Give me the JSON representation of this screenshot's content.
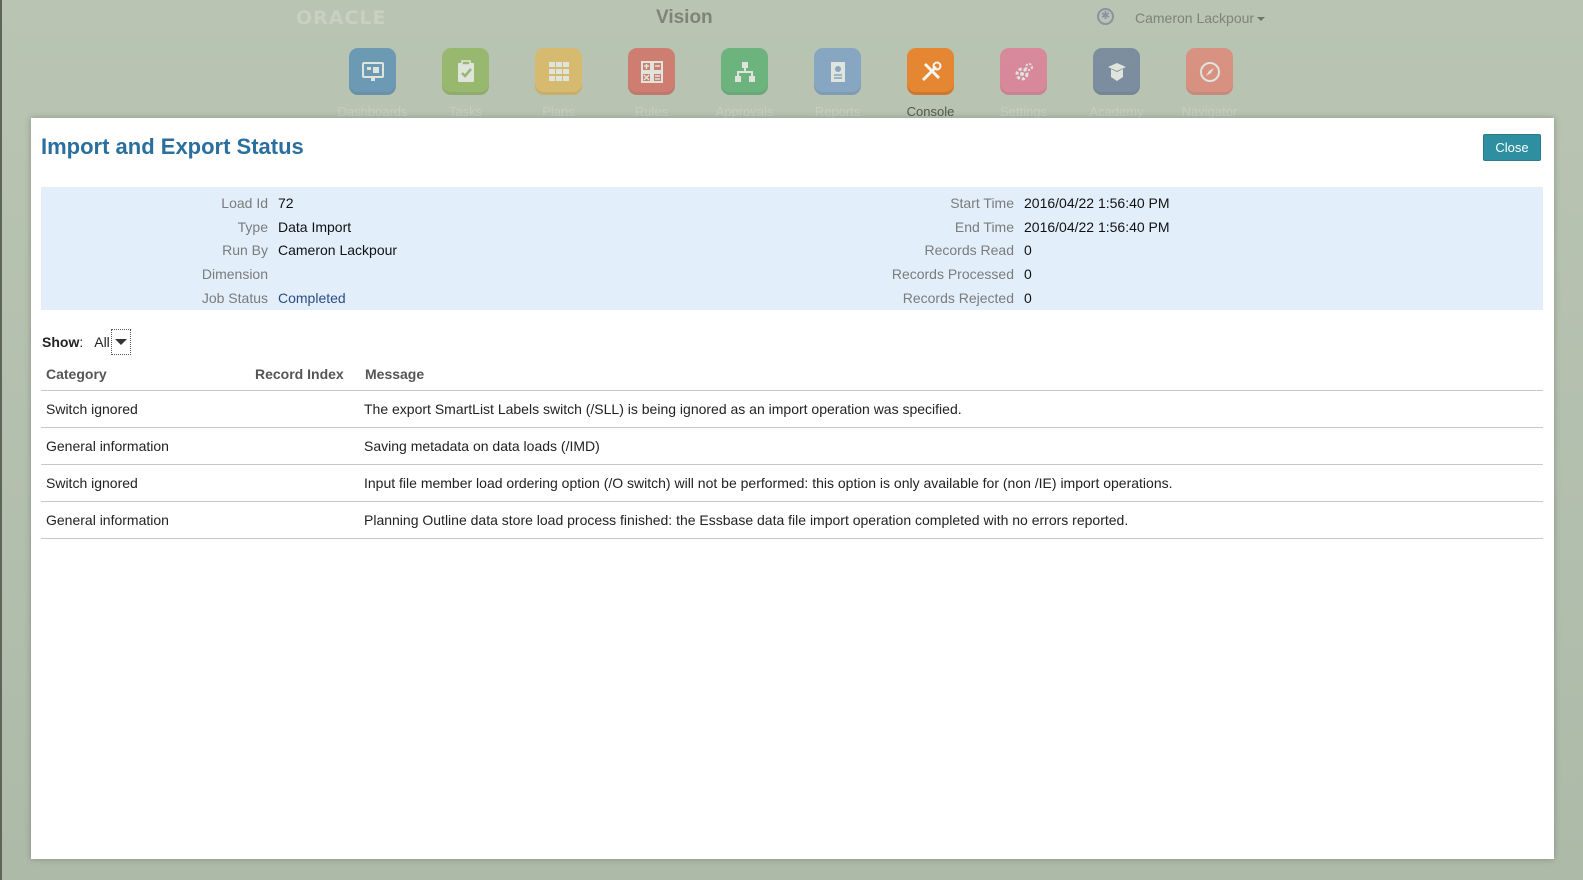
{
  "header": {
    "logo_text": "ORACLE",
    "app_title": "Vision",
    "user_name": "Cameron Lackpour",
    "accessibility_icon": "accessibility-icon"
  },
  "nav": [
    {
      "label": "Dashboards",
      "icon": "dashboard-icon",
      "color": "#2f78b5"
    },
    {
      "label": "Tasks",
      "icon": "clipboard-check-icon",
      "color": "#7fb03c"
    },
    {
      "label": "Plans",
      "icon": "grid-icon",
      "color": "#f0b33a"
    },
    {
      "label": "Rules",
      "icon": "calculator-icon",
      "color": "#e0453c"
    },
    {
      "label": "Approvals",
      "icon": "hierarchy-icon",
      "color": "#2fa655"
    },
    {
      "label": "Reports",
      "icon": "report-icon",
      "color": "#5e8fd0"
    },
    {
      "label": "Console",
      "icon": "tools-icon",
      "color": "#ee7c1c"
    },
    {
      "label": "Settings",
      "icon": "gears-icon",
      "color": "#f25a8a"
    },
    {
      "label": "Academy",
      "icon": "graduation-icon",
      "color": "#4b6290"
    },
    {
      "label": "Navigator",
      "icon": "compass-icon",
      "color": "#f36a5a"
    }
  ],
  "dialog": {
    "title": "Import and Export Status",
    "close_label": "Close",
    "summary_left": [
      {
        "label": "Load Id",
        "value": "72"
      },
      {
        "label": "Type",
        "value": "Data Import"
      },
      {
        "label": "Run By",
        "value": "Cameron Lackpour"
      },
      {
        "label": "Dimension",
        "value": ""
      },
      {
        "label": "Job Status",
        "value": "Completed"
      }
    ],
    "summary_right": [
      {
        "label": "Start Time",
        "value": "2016/04/22 1:56:40 PM"
      },
      {
        "label": "End Time",
        "value": "2016/04/22 1:56:40 PM"
      },
      {
        "label": "Records Read",
        "value": "0"
      },
      {
        "label": "Records Processed",
        "value": "0"
      },
      {
        "label": "Records Rejected",
        "value": "0"
      }
    ],
    "show_label": "Show",
    "show_value": "All",
    "columns": [
      "Category",
      "Record Index",
      "Message"
    ],
    "rows": [
      {
        "category": "Switch ignored",
        "record_index": "",
        "message": "The export SmartList Labels switch (/SLL) is being ignored as an import operation was specified."
      },
      {
        "category": "General information",
        "record_index": "",
        "message": "Saving metadata on data loads (/IMD)"
      },
      {
        "category": "Switch ignored",
        "record_index": "",
        "message": "Input file member load ordering option (/O switch) will not be performed: this option is only available for (non /IE) import operations."
      },
      {
        "category": "General information",
        "record_index": "",
        "message": "Planning Outline data store load process finished: the Essbase data file import operation completed with no errors reported."
      }
    ]
  }
}
